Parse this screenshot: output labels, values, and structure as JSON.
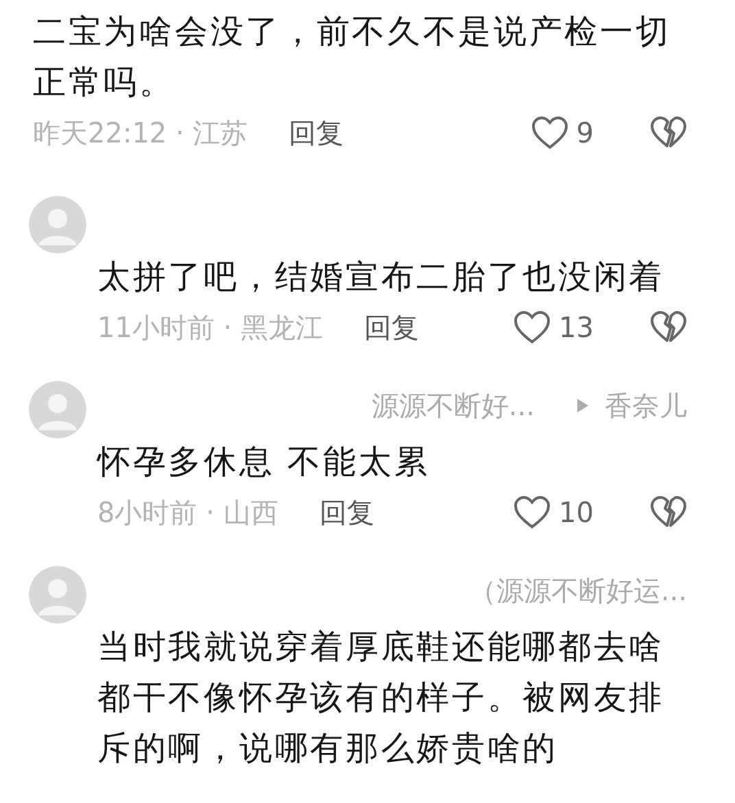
{
  "comments": [
    {
      "kind": "top",
      "text": "二宝为啥会没了，前不久不是说产检一切正常吗。",
      "time": "昨天22:12 · 江苏",
      "reply": "回复",
      "likes": "9"
    },
    {
      "kind": "reply",
      "text": "太拼了吧，结婚宣布二胎了也没闲着",
      "time": "11小时前 · 黑龙江",
      "reply": "回复",
      "likes": "13"
    },
    {
      "kind": "reply",
      "author": "源源不断好...",
      "reply_to": "香奈儿",
      "text": "怀孕多休息 不能太累",
      "time": "8小时前 · 山西",
      "reply": "回复",
      "likes": "10"
    },
    {
      "kind": "reply",
      "author": "（源源不断好运...",
      "text": "当时我就说穿着厚底鞋还能哪都去啥都干不像怀孕该有的样子。被网友排斥的啊，说哪有那么娇贵啥的"
    }
  ]
}
